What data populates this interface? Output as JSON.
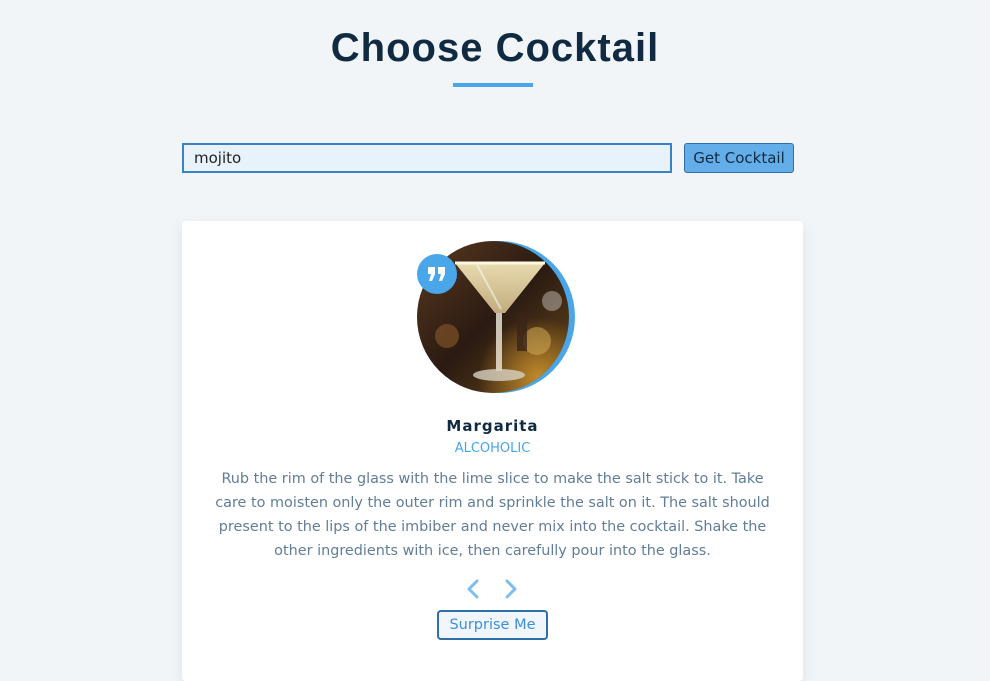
{
  "header": {
    "title": "Choose Cocktail"
  },
  "search": {
    "value": "mojito",
    "button_label": "Get Cocktail"
  },
  "card": {
    "image_icon": "cocktail-photo",
    "badge_icon": "quote-icon",
    "name": "Margarita",
    "category": "Alcoholic",
    "description": "Rub the rim of the glass with the lime slice to make the salt stick to it. Take care to moisten only the outer rim and sprinkle the salt on it. The salt should present to the lips of the imbiber and never mix into the cocktail. Shake the other ingredients with ice, then carefully pour into the glass.",
    "prev_icon": "chevron-left-icon",
    "next_icon": "chevron-right-icon",
    "surprise_label": "Surprise Me"
  },
  "colors": {
    "background": "#f1f5f8",
    "title": "#102a42",
    "accent": "#49a6e9",
    "muted_text": "#617d98",
    "card_background": "#ffffff"
  }
}
